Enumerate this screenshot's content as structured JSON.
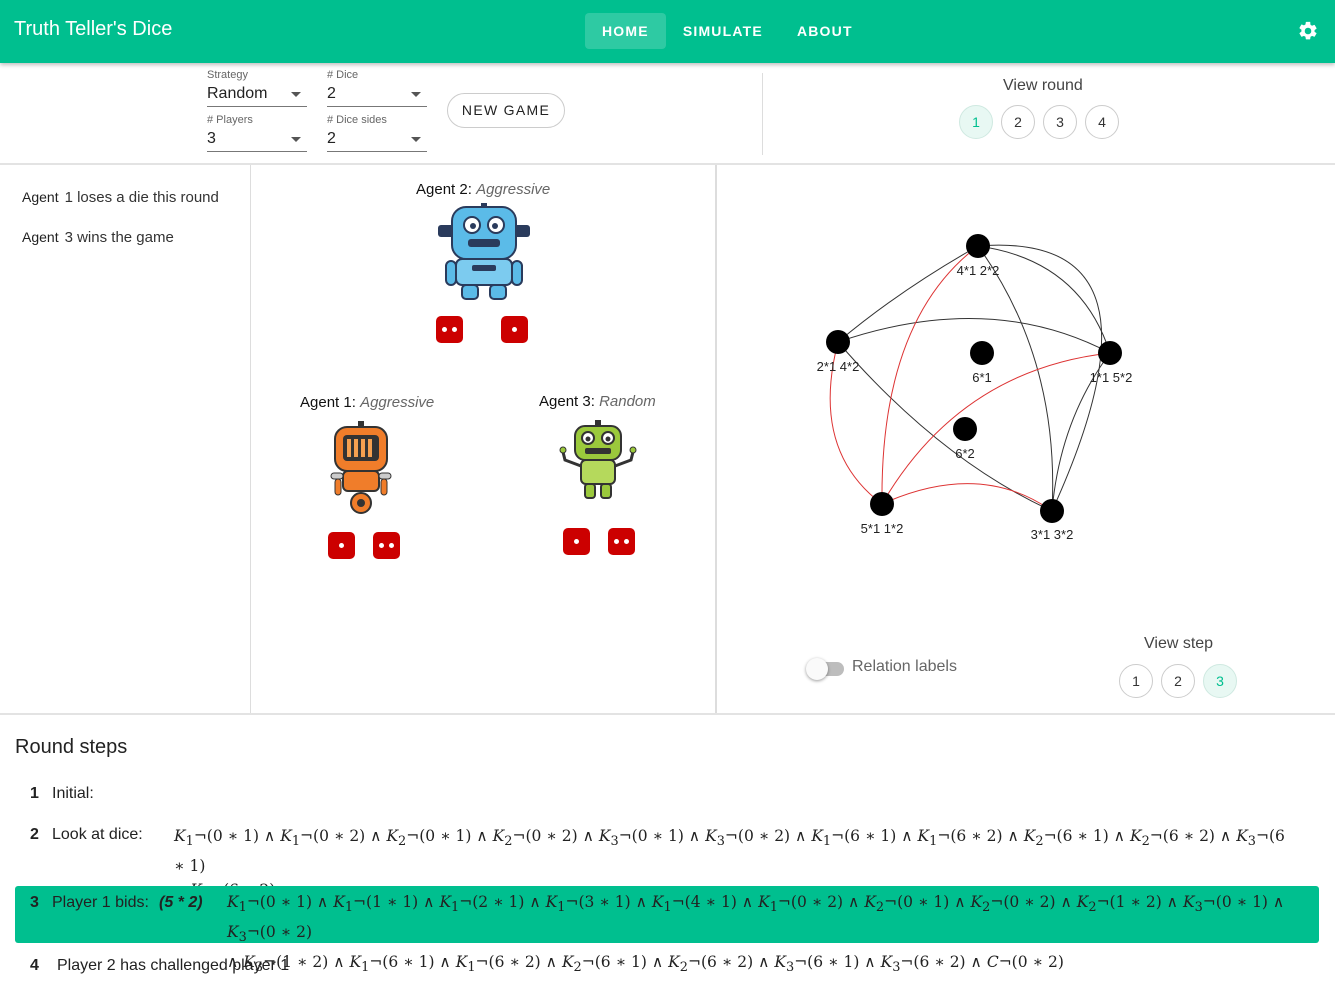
{
  "app": {
    "title": "Truth Teller's Dice"
  },
  "nav": {
    "home": "HOME",
    "simulate": "SIMULATE",
    "about": "ABOUT"
  },
  "controls": {
    "strategy": {
      "label": "Strategy",
      "value": "Random"
    },
    "dice": {
      "label": "# Dice",
      "value": "2"
    },
    "players": {
      "label": "# Players",
      "value": "3"
    },
    "dice_sides": {
      "label": "# Dice sides",
      "value": "2"
    },
    "new_game": "NEW GAME",
    "view_round_label": "View round",
    "rounds": [
      "1",
      "2",
      "3",
      "4"
    ],
    "selected_round": "1"
  },
  "log": [
    {
      "agent": "Agent",
      "text": "1 loses a die this round"
    },
    {
      "agent": "Agent",
      "text": "3 wins the game"
    }
  ],
  "agents": [
    {
      "label": "Agent",
      "num": "2:",
      "strategy": "Aggressive",
      "dice": [
        2,
        1
      ]
    },
    {
      "label": "Agent",
      "num": "1:",
      "strategy": "Aggressive",
      "dice": [
        1,
        2
      ]
    },
    {
      "label": "Agent",
      "num": "3:",
      "strategy": "Random",
      "dice": [
        1,
        2
      ]
    }
  ],
  "graph": {
    "nodes": [
      "4*1 2*2",
      "2*1 4*2",
      "6*1",
      "1*1 5*2",
      "6*2",
      "5*1 1*2",
      "3*1 3*2"
    ],
    "edge_colors": {
      "black": "#333333",
      "red": "#dd3333"
    },
    "relation_labels": "Relation labels",
    "relation_labels_on": false,
    "view_step_label": "View step",
    "steps": [
      "1",
      "2",
      "3"
    ],
    "selected_step": "3"
  },
  "round_steps": {
    "title": "Round steps",
    "items": [
      {
        "num": "1",
        "label": "Initial:"
      },
      {
        "num": "2",
        "label": "Look at dice:"
      },
      {
        "num": "3",
        "label": "Player 1 bids:",
        "bid": "(5 * 2)"
      },
      {
        "num": "4",
        "label": "Player 2 has challenged player 1"
      }
    ]
  },
  "colors": {
    "accent": "#00bf8f",
    "die": "#cc0000"
  }
}
